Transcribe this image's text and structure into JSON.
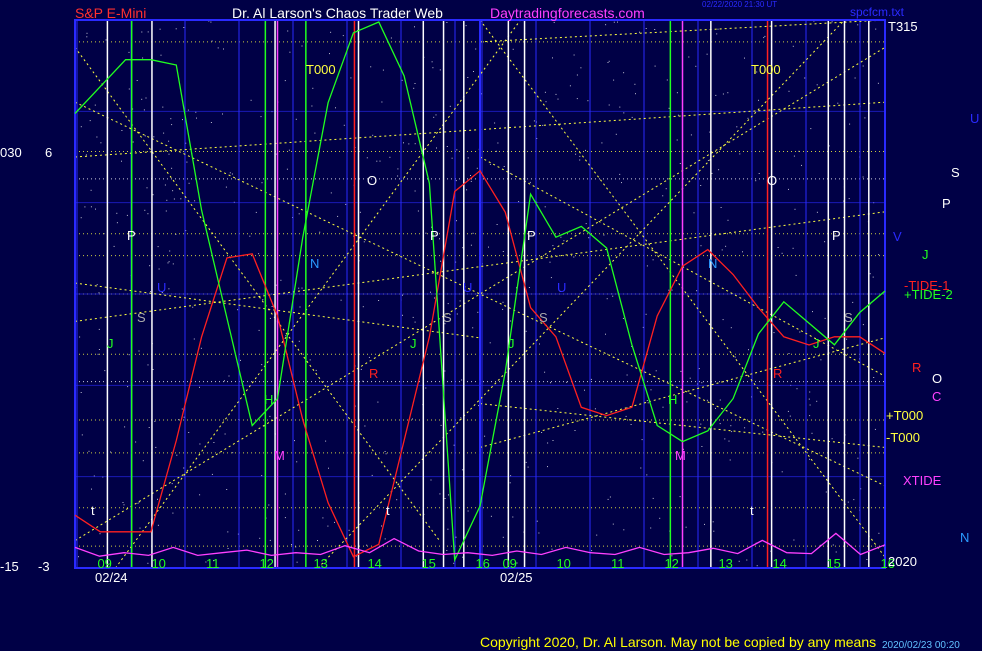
{
  "header": {
    "left_title": "S&P E-Mini",
    "center_title": "Dr. Al Larson's Chaos Trader Web",
    "site": "Daytradingforecasts.com",
    "top_right": "spcfcm.txt",
    "small_stamp": "02/22/2020 21:30 UT"
  },
  "footer": {
    "copyright": "Copyright 2020, Dr. Al Larson. May not be copied by any means",
    "stamp": "2020/02/23 00:20"
  },
  "colors": {
    "background": "#000046",
    "frame": "#2a2aff",
    "red_line": "#ff2020",
    "green_line": "#20ff20",
    "magenta_line": "#ff40ff",
    "yellow_line": "#ffff40",
    "white_line": "#ffffff"
  },
  "chart_data": {
    "type": "line",
    "title": "S&P E-Mini",
    "panels": [
      {
        "date_label": "02/24",
        "hour_ticks": [
          "09",
          "10",
          "11",
          "12",
          "13",
          "14",
          "15",
          "16"
        ]
      },
      {
        "date_label": "02/25",
        "hour_ticks": [
          "09",
          "10",
          "11",
          "12",
          "13",
          "14",
          "15",
          "16"
        ]
      }
    ],
    "left_axis_top": [
      "030",
      "6"
    ],
    "left_axis_bottom": [
      "-15",
      "-3"
    ],
    "right_axis_top": "T315",
    "right_axis_bottom": "2020",
    "series": [
      {
        "name": "TIDE-1",
        "color": "red",
        "values": [
          0.12,
          0.08,
          0.08,
          0.08,
          0.3,
          0.55,
          0.74,
          0.75,
          0.6,
          0.35,
          0.15,
          0.02,
          0.05,
          0.3,
          0.55,
          0.9,
          0.95,
          0.85,
          0.62,
          0.55,
          0.38,
          0.36,
          0.38,
          0.6,
          0.72,
          0.76,
          0.7,
          0.62,
          0.55,
          0.53,
          0.55,
          0.55,
          0.51
        ]
      },
      {
        "name": "TIDE-2",
        "color": "green",
        "values": [
          0.83,
          0.88,
          0.93,
          0.93,
          0.92,
          0.65,
          0.45,
          0.25,
          0.3,
          0.6,
          0.85,
          0.98,
          1.0,
          0.9,
          0.7,
          0.0,
          0.1,
          0.35,
          0.68,
          0.6,
          0.62,
          0.58,
          0.4,
          0.25,
          0.22,
          0.24,
          0.3,
          0.42,
          0.48,
          0.44,
          0.4,
          0.46,
          0.5
        ]
      },
      {
        "name": "XTIDE",
        "color": "magenta",
        "values": [
          0.12,
          0.02,
          0.06,
          0.03,
          0.12,
          0.03,
          0.06,
          0.09,
          0.03,
          0.06,
          0.04,
          0.14,
          0.06,
          0.22,
          0.08,
          0.04,
          0.06,
          0.03,
          0.08,
          0.04,
          0.12,
          0.06,
          0.04,
          0.12,
          0.04,
          0.06,
          0.11,
          0.05,
          0.2,
          0.06,
          0.05,
          0.28,
          0.04,
          0.15
        ]
      }
    ],
    "vertical_markers": [
      "P",
      "S",
      "J",
      "U",
      "H",
      "M",
      "N",
      "T000",
      "O",
      "R",
      "t"
    ],
    "right_labels": [
      {
        "text": "U",
        "color": "#2a2aff"
      },
      {
        "text": "S",
        "color": "#ffffff"
      },
      {
        "text": "P",
        "color": "#ffffff"
      },
      {
        "text": "V",
        "color": "#2a2aff"
      },
      {
        "text": "J",
        "color": "#20ff20"
      },
      {
        "text": "-TIDE-1",
        "color": "#ff2020"
      },
      {
        "text": "+TIDE-2",
        "color": "#20ff20"
      },
      {
        "text": "R",
        "color": "#ff2020"
      },
      {
        "text": "O",
        "color": "#ffffff"
      },
      {
        "text": "C",
        "color": "#ff40ff"
      },
      {
        "text": "+T000",
        "color": "#ffff40"
      },
      {
        "text": "-T000",
        "color": "#ffff40"
      },
      {
        "text": "XTIDE",
        "color": "#ff40ff"
      },
      {
        "text": "N",
        "color": "#2a9aff"
      }
    ],
    "grid": true
  }
}
